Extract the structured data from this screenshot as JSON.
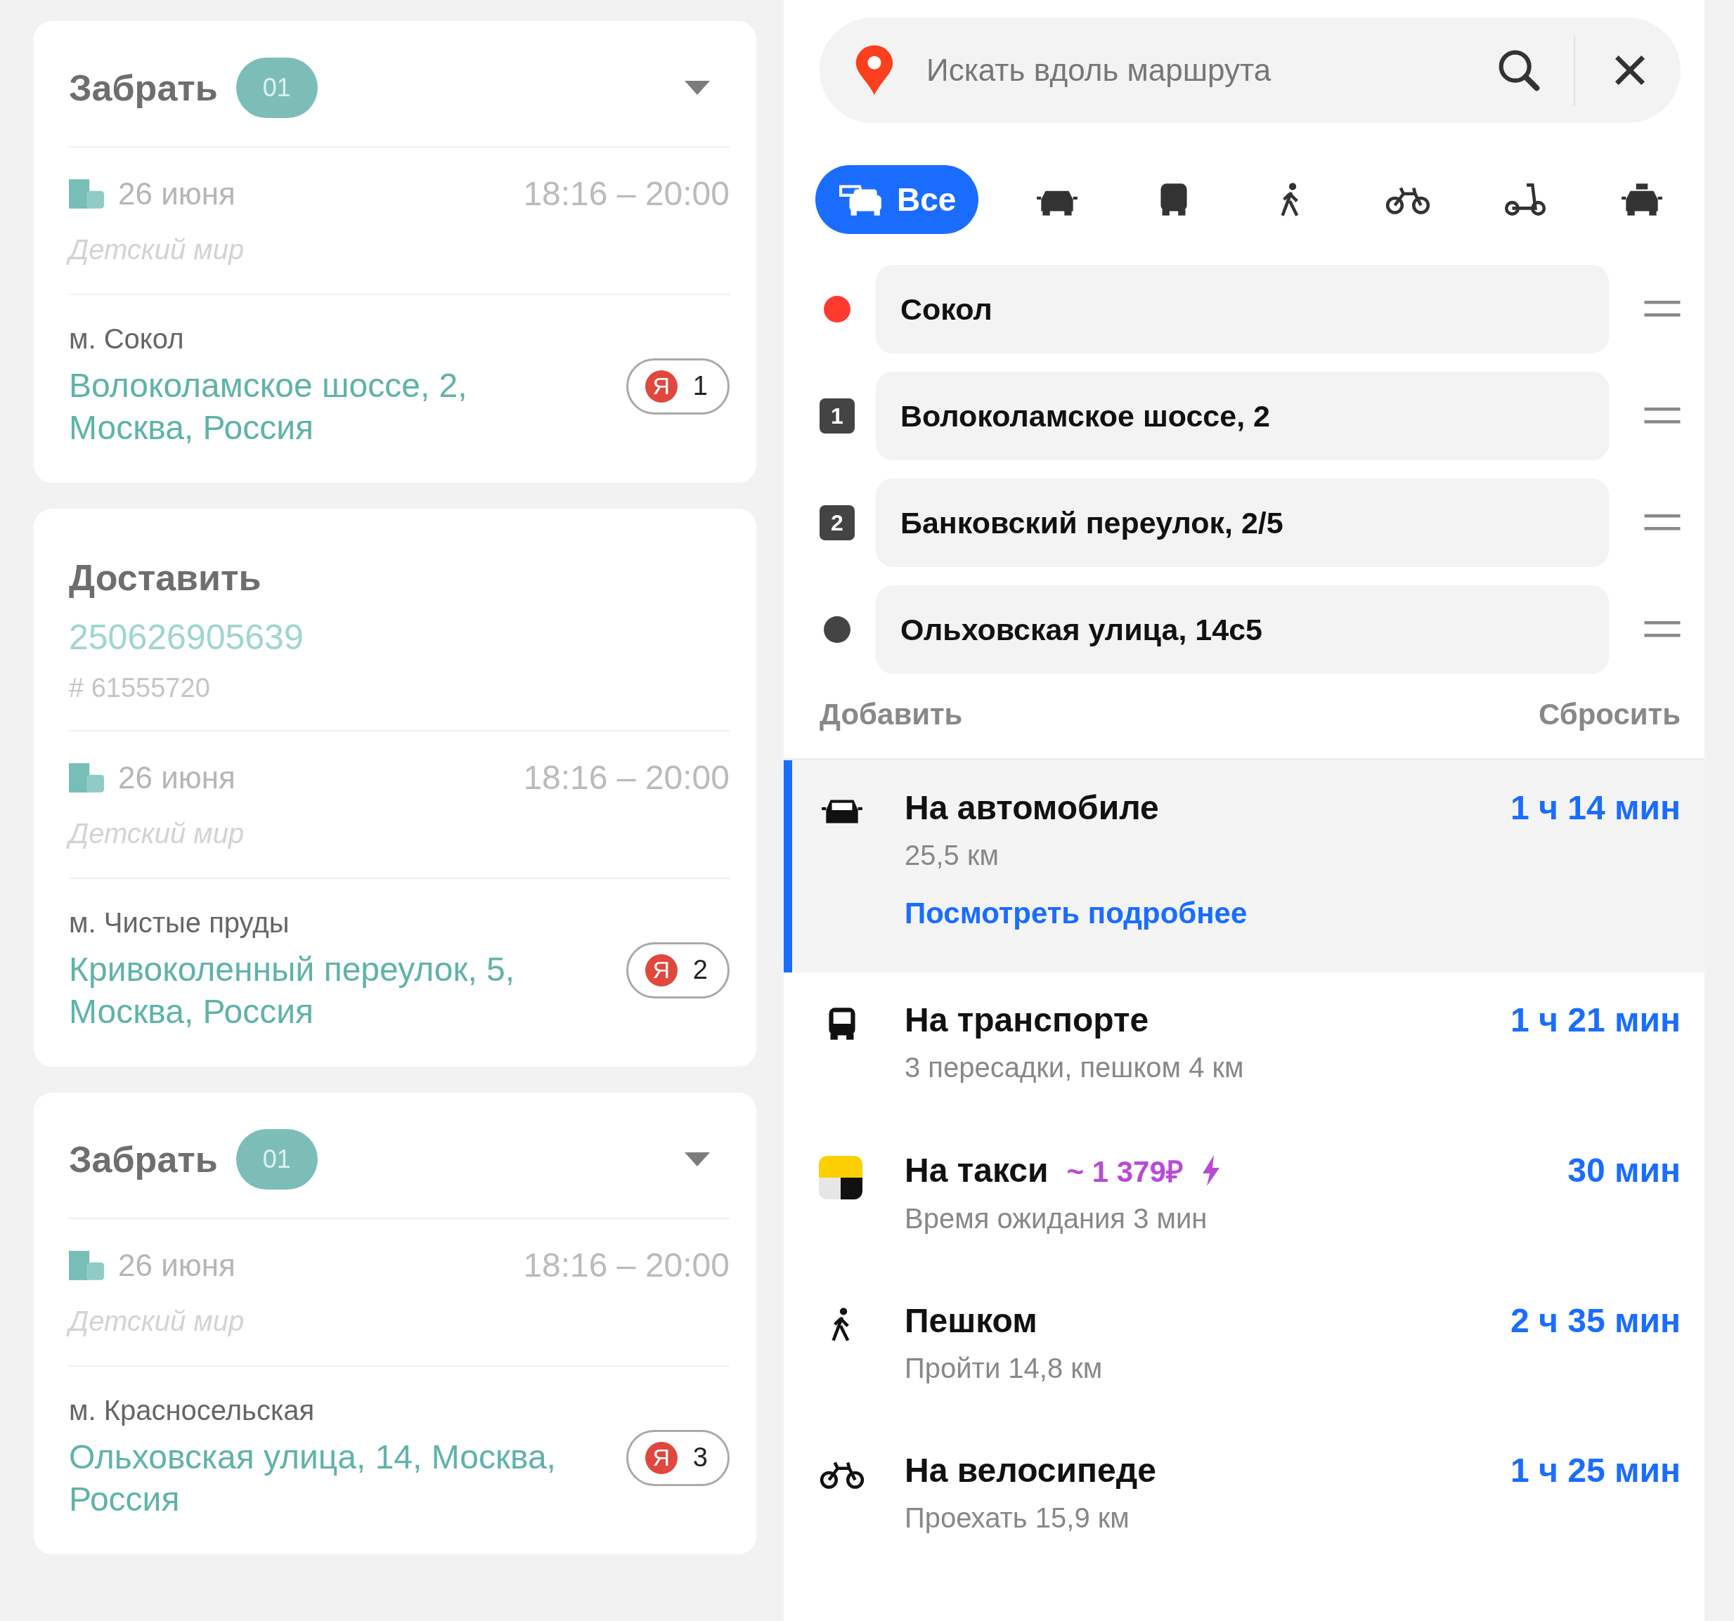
{
  "cards": [
    {
      "kind": "pickup",
      "title": "Забрать",
      "count": "01",
      "date": "26 июня",
      "time": "18:16 – 20:00",
      "shop": "Детский мир",
      "metro": "м. Сокол",
      "address": "Волоколамское шоссе, 2, Москва, Россия",
      "logo": "Я",
      "stop": "1"
    },
    {
      "kind": "delivery",
      "title": "Доставить",
      "order": "250626905639",
      "order_id": "# 61555720",
      "date": "26 июня",
      "time": "18:16 – 20:00",
      "shop": "Детский мир",
      "metro": "м. Чистые пруды",
      "address": "Кривоколенный переулок, 5, Москва, Россия",
      "logo": "Я",
      "stop": "2"
    },
    {
      "kind": "pickup",
      "title": "Забрать",
      "count": "01",
      "date": "26 июня",
      "time": "18:16 – 20:00",
      "shop": "Детский мир",
      "metro": "м. Красносельская",
      "address": "Ольховская улица, 14, Москва, Россия",
      "logo": "Я",
      "stop": "3"
    }
  ],
  "search": {
    "placeholder": "Искать вдоль маршрута"
  },
  "modes": [
    {
      "kind": "all",
      "label": "Все",
      "selected": true
    },
    {
      "kind": "car",
      "selected": false
    },
    {
      "kind": "bus",
      "selected": false
    },
    {
      "kind": "walk",
      "selected": false
    },
    {
      "kind": "bike",
      "selected": false
    },
    {
      "kind": "scooter",
      "selected": false
    },
    {
      "kind": "taxi",
      "selected": false
    }
  ],
  "waypoints": [
    {
      "kind": "start",
      "label": "Сокол"
    },
    {
      "kind": "stop",
      "number": "1",
      "label": "Волоколамское шоссе, 2"
    },
    {
      "kind": "stop",
      "number": "2",
      "label": "Банковский переулок, 2/5"
    },
    {
      "kind": "end",
      "label": "Ольховская улица, 14с5"
    }
  ],
  "add_label": "Добавить",
  "reset_label": "Сбросить",
  "routes": [
    {
      "kind": "car",
      "title": "На автомобиле",
      "detail": "25,5 км",
      "duration": "1 ч 14 мин",
      "link": "Посмотреть подробнее",
      "selected": true
    },
    {
      "kind": "bus",
      "title": "На транспорте",
      "detail": "3 пересадки, пешком 4 км",
      "duration": "1 ч 21 мин",
      "selected": false
    },
    {
      "kind": "taxi",
      "title": "На такси",
      "price": "~ 1 379₽",
      "surge": true,
      "detail": "Время ожидания 3 мин",
      "duration": "30 мин",
      "selected": false
    },
    {
      "kind": "walk",
      "title": "Пешком",
      "detail": "Пройти 14,8 км",
      "duration": "2 ч 35 мин",
      "selected": false
    },
    {
      "kind": "bike",
      "title": "На велосипеде",
      "detail": "Проехать 15,9 км",
      "duration": "1 ч 25 мин",
      "selected": false
    }
  ]
}
